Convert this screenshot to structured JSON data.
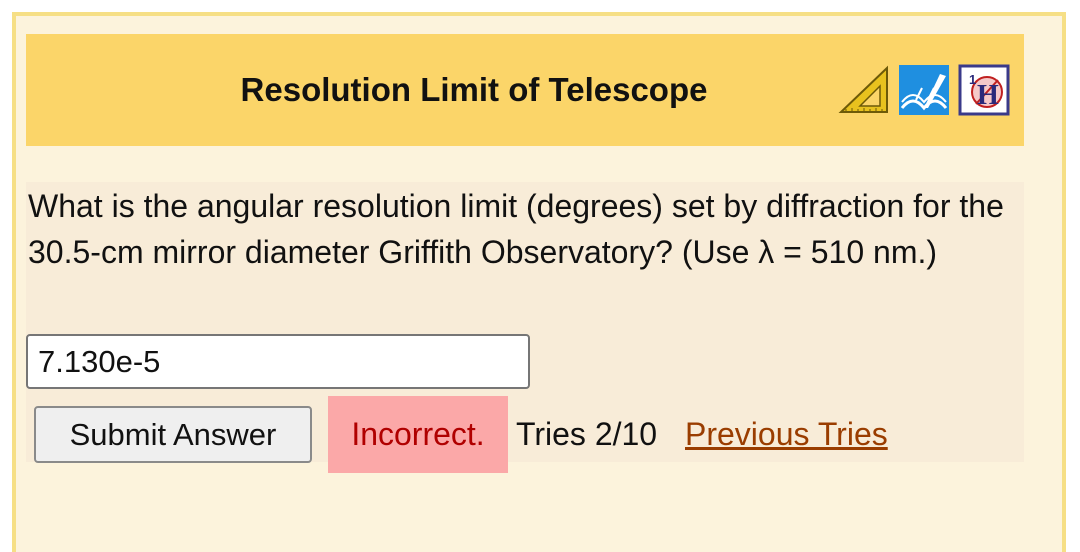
{
  "header": {
    "title": "Resolution Limit of Telescope",
    "icons": [
      "triangle-ruler-icon",
      "open-book-icon",
      "help-hint-icon"
    ],
    "hint_icon_text": "H",
    "hint_icon_sup": "1"
  },
  "problem": {
    "question": "What is the angular resolution limit (degrees) set by diffraction for the 30.5-cm mirror diameter Griffith Observatory? (Use λ = 510 nm.)",
    "answer_value": "7.130e-5",
    "submit_label": "Submit Answer",
    "feedback": "Incorrect.",
    "tries_text": "Tries 2/10",
    "previous_tries_label": "Previous Tries"
  },
  "colors": {
    "frame_border": "#f6df85",
    "frame_background": "#fcf3dc",
    "header_background": "#fbd569",
    "content_background": "#f8ecd8",
    "incorrect_background": "#fba8a8",
    "incorrect_text": "#b00000",
    "link": "#9a3d00"
  }
}
